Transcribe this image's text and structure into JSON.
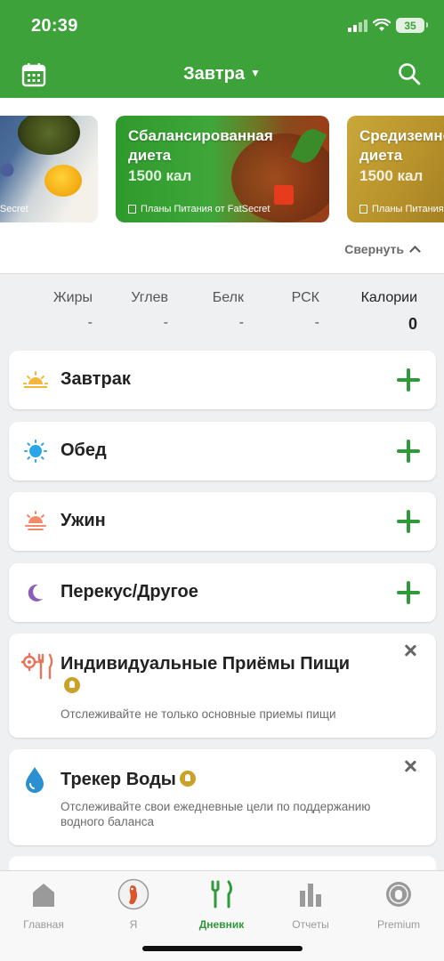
{
  "status": {
    "time": "20:39",
    "battery": "35"
  },
  "nav": {
    "title": "Завтра"
  },
  "banners": [
    {
      "title": "",
      "kcal": "",
      "footer": "от FatSecret"
    },
    {
      "title": "Сбалансированная диета",
      "kcal": "1500 кал",
      "footer": "Планы Питания от FatSecret"
    },
    {
      "title": "Средиземноморская диета",
      "kcal": "1500 кал",
      "footer": "Планы Питания от FatSecret"
    }
  ],
  "collapse_label": "Свернуть",
  "nutrients": [
    {
      "label": "Жиры",
      "value": "-"
    },
    {
      "label": "Углев",
      "value": "-"
    },
    {
      "label": "Белк",
      "value": "-"
    },
    {
      "label": "РСК",
      "value": "-"
    },
    {
      "label": "Калории",
      "value": "0"
    }
  ],
  "meals": [
    {
      "label": "Завтрак",
      "icon": "sunrise-icon"
    },
    {
      "label": "Обед",
      "icon": "sun-icon"
    },
    {
      "label": "Ужин",
      "icon": "sunset-icon"
    },
    {
      "label": "Перекус/Другое",
      "icon": "moon-icon"
    }
  ],
  "features": [
    {
      "title": "Индивидуальные Приёмы Пищи",
      "desc": "Отслеживайте не только основные приемы пищи",
      "icon": "cutlery-gear-icon"
    },
    {
      "title": "Трекер Воды",
      "desc": "Отслеживайте свои ежедневные цели по поддержанию водного баланса",
      "icon": "water-drop-icon"
    }
  ],
  "tabs": [
    {
      "label": "Главная",
      "icon": "home-icon"
    },
    {
      "label": "Я",
      "icon": "avatar-icon"
    },
    {
      "label": "Дневник",
      "icon": "cutlery-icon",
      "active": true
    },
    {
      "label": "Отчеты",
      "icon": "bar-chart-icon"
    },
    {
      "label": "Premium",
      "icon": "premium-lock-icon"
    }
  ],
  "colors": {
    "brand": "#3da239",
    "plus": "#2f9a3a",
    "premium": "#c9a227"
  }
}
